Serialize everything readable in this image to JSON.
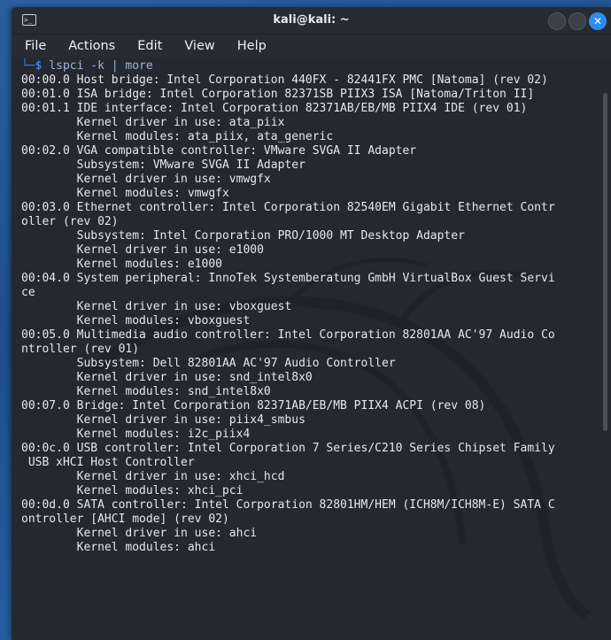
{
  "window": {
    "title": "kali@kali: ~",
    "app_icon": "terminal-icon",
    "close_glyph": "✕"
  },
  "menu": [
    "File",
    "Actions",
    "Edit",
    "View",
    "Help"
  ],
  "prompt": {
    "corner": "└─",
    "dollar": "$",
    "command": " lspci -k | more"
  },
  "output": [
    "00:00.0 Host bridge: Intel Corporation 440FX - 82441FX PMC [Natoma] (rev 02)",
    "00:01.0 ISA bridge: Intel Corporation 82371SB PIIX3 ISA [Natoma/Triton II]",
    "00:01.1 IDE interface: Intel Corporation 82371AB/EB/MB PIIX4 IDE (rev 01)",
    "        Kernel driver in use: ata_piix",
    "        Kernel modules: ata_piix, ata_generic",
    "00:02.0 VGA compatible controller: VMware SVGA II Adapter",
    "        Subsystem: VMware SVGA II Adapter",
    "        Kernel driver in use: vmwgfx",
    "        Kernel modules: vmwgfx",
    "00:03.0 Ethernet controller: Intel Corporation 82540EM Gigabit Ethernet Contr",
    "oller (rev 02)",
    "        Subsystem: Intel Corporation PRO/1000 MT Desktop Adapter",
    "        Kernel driver in use: e1000",
    "        Kernel modules: e1000",
    "00:04.0 System peripheral: InnoTek Systemberatung GmbH VirtualBox Guest Servi",
    "ce",
    "        Kernel driver in use: vboxguest",
    "        Kernel modules: vboxguest",
    "00:05.0 Multimedia audio controller: Intel Corporation 82801AA AC'97 Audio Co",
    "ntroller (rev 01)",
    "        Subsystem: Dell 82801AA AC'97 Audio Controller",
    "        Kernel driver in use: snd_intel8x0",
    "        Kernel modules: snd_intel8x0",
    "00:07.0 Bridge: Intel Corporation 82371AB/EB/MB PIIX4 ACPI (rev 08)",
    "        Kernel driver in use: piix4_smbus",
    "        Kernel modules: i2c_piix4",
    "00:0c.0 USB controller: Intel Corporation 7 Series/C210 Series Chipset Family",
    " USB xHCI Host Controller",
    "        Kernel driver in use: xhci_hcd",
    "        Kernel modules: xhci_pci",
    "00:0d.0 SATA controller: Intel Corporation 82801HM/HEM (ICH8M/ICH8M-E) SATA C",
    "ontroller [AHCI mode] (rev 02)",
    "        Kernel driver in use: ahci",
    "        Kernel modules: ahci"
  ]
}
